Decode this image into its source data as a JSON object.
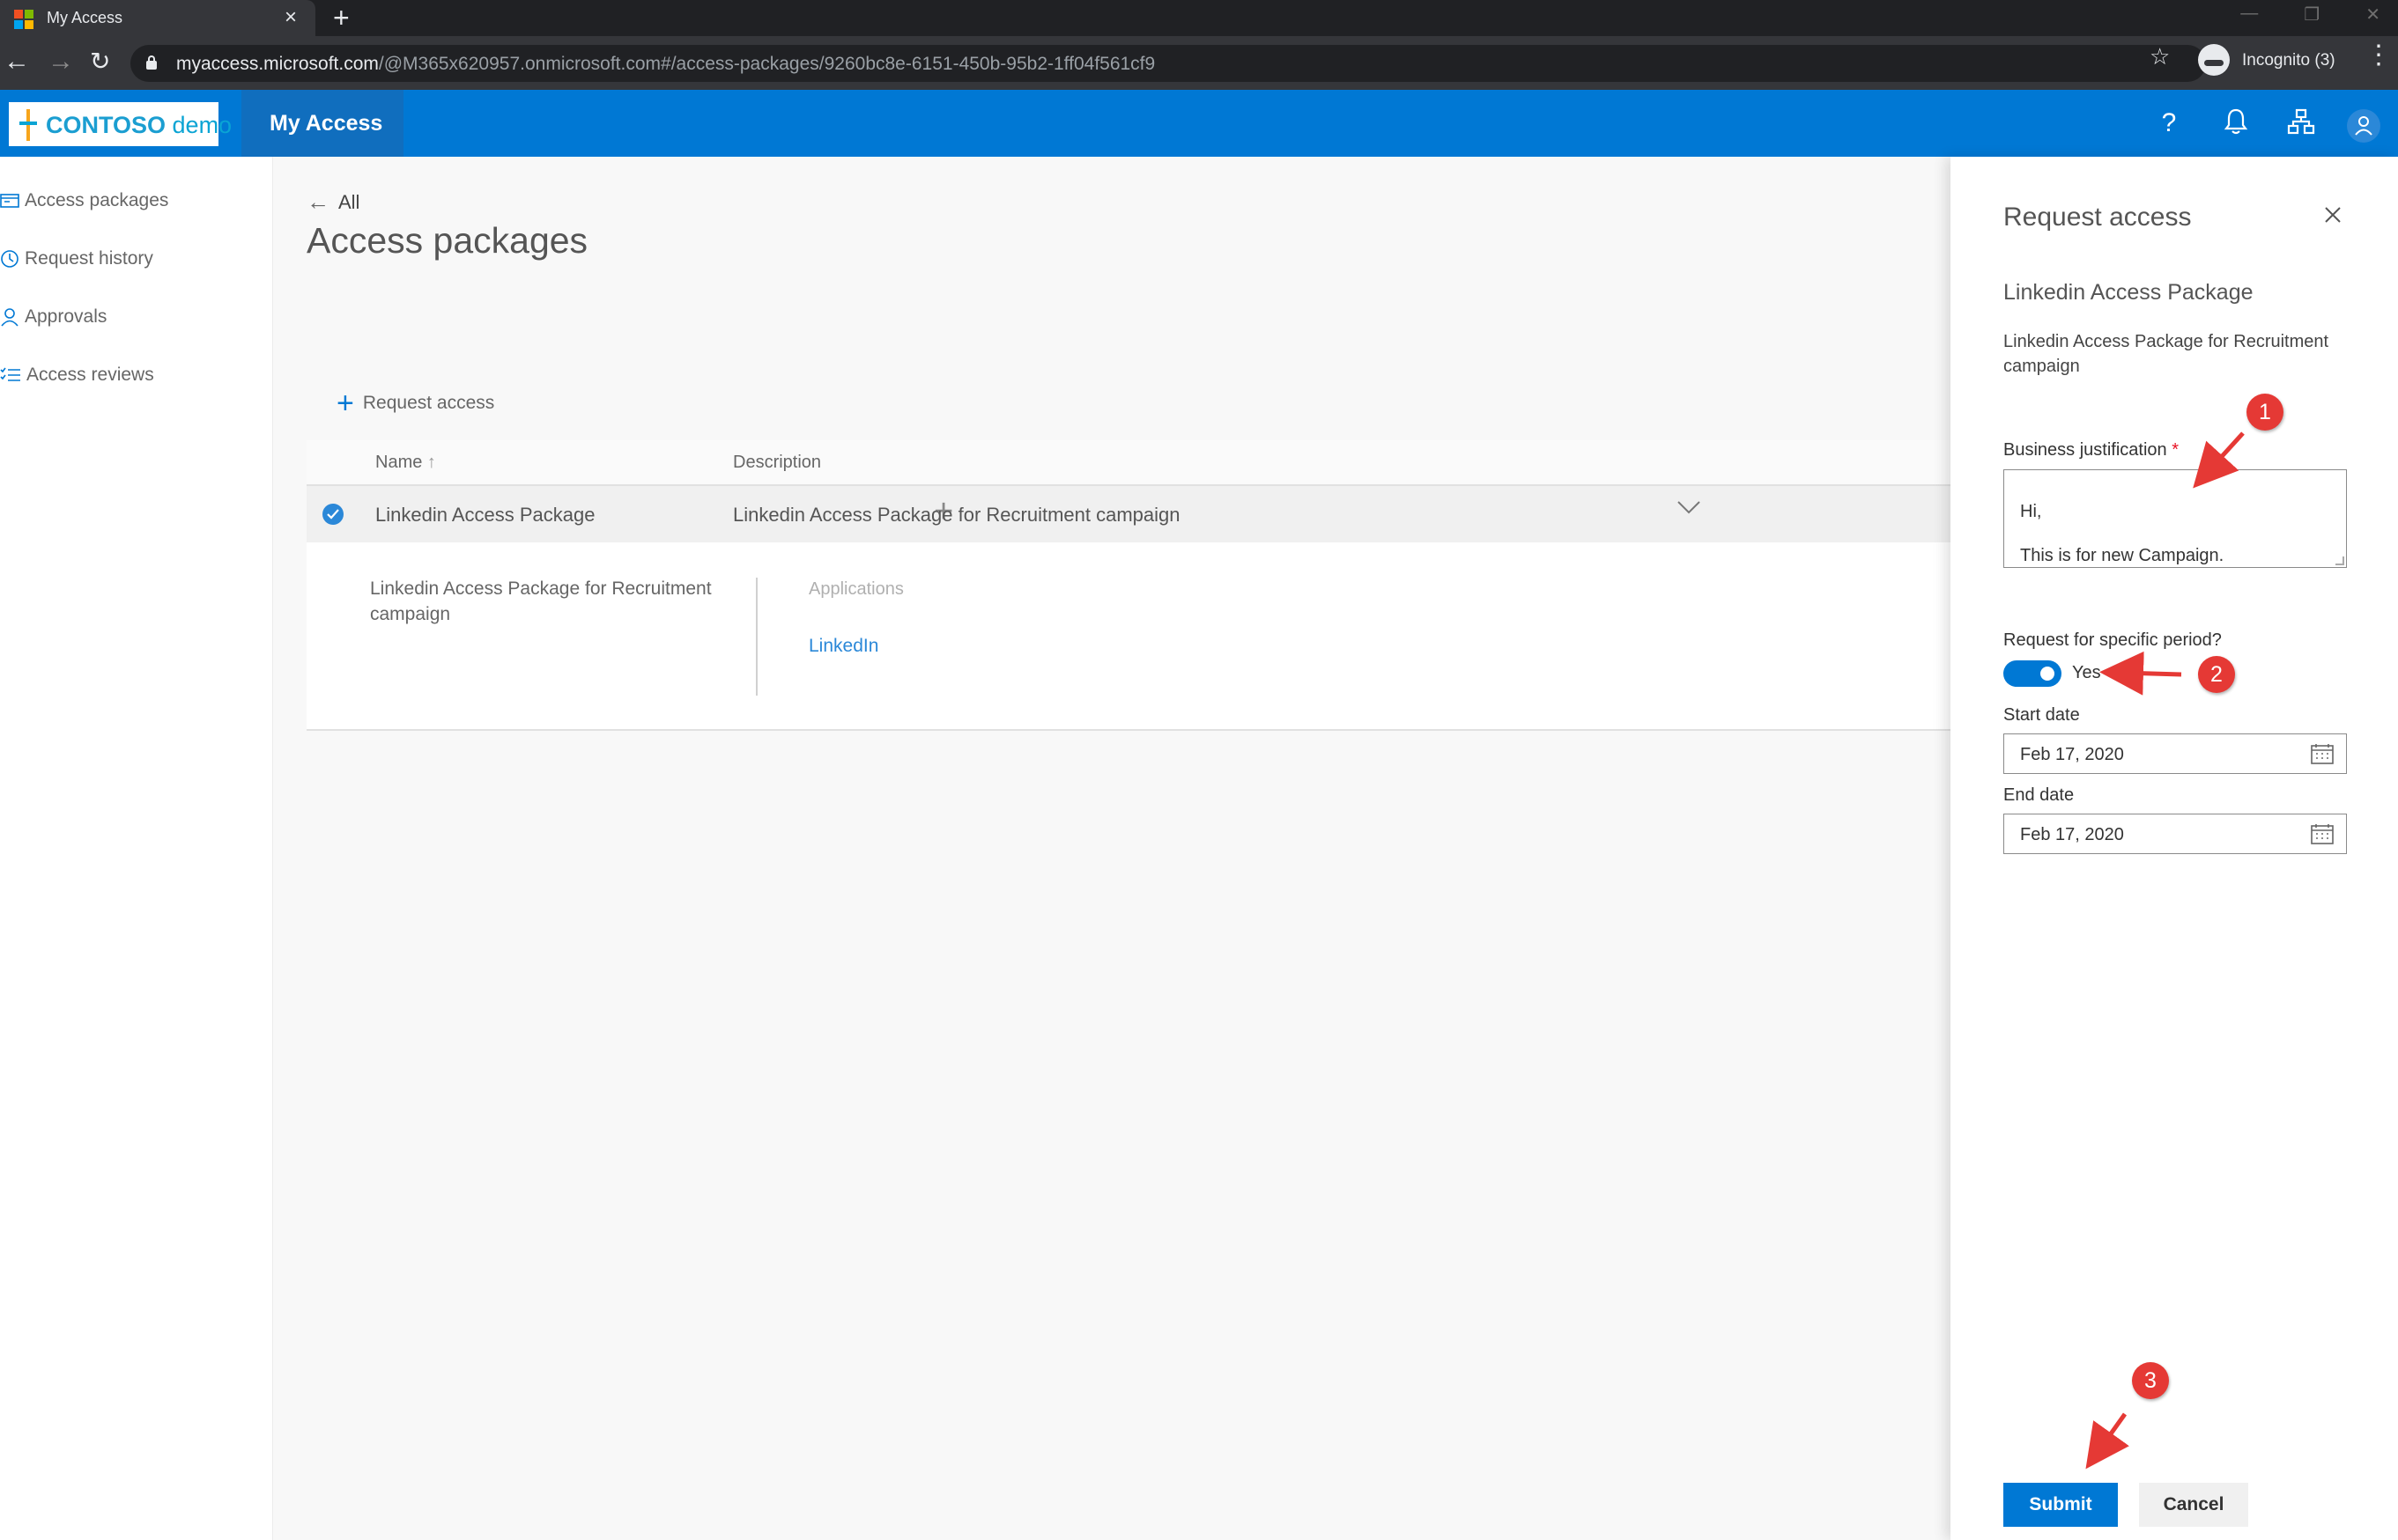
{
  "browser": {
    "tab_title": "My Access",
    "url_host": "myaccess.microsoft.com",
    "url_path": "/@M365x620957.onmicrosoft.com#/access-packages/9260bc8e-6151-450b-95b2-1ff04f561cf9",
    "incognito_label": "Incognito (3)"
  },
  "header": {
    "logo_brand": "CONTOSO",
    "logo_suffix": "demo",
    "app_title": "My Access",
    "icons": [
      "help-icon",
      "notification-bell-icon",
      "org-chart-icon",
      "user-avatar-icon"
    ],
    "accent_color": "#0078d4"
  },
  "sidebar": {
    "items": [
      {
        "label": "Access packages",
        "icon": "access-packages-icon"
      },
      {
        "label": "Request history",
        "icon": "history-icon"
      },
      {
        "label": "Approvals",
        "icon": "person-icon"
      },
      {
        "label": "Access reviews",
        "icon": "checklist-icon"
      }
    ]
  },
  "main": {
    "back_label": "All",
    "page_title": "Access packages",
    "request_access_label": "Request access",
    "columns": {
      "name": "Name",
      "description": "Description"
    },
    "row": {
      "name": "Linkedin Access Package",
      "description": "Linkedin Access Package for Recruitment campaign",
      "selected": true
    },
    "detail": {
      "description": "Linkedin Access Package for Recruitment campaign",
      "applications_label": "Applications",
      "applications": [
        "LinkedIn"
      ]
    }
  },
  "panel": {
    "title": "Request access",
    "package_name": "Linkedin Access Package",
    "package_description": "Linkedin Access Package for Recruitment campaign",
    "justification_label": "Business justification",
    "justification_required_mark": "*",
    "justification_value": "Hi,\n\nThis is for new Campaign.",
    "period_label": "Request for specific period?",
    "period_toggle_text": "Yes",
    "period_enabled": true,
    "start_date_label": "Start date",
    "start_date_value": "Feb 17, 2020",
    "end_date_label": "End date",
    "end_date_value": "Feb 17, 2020",
    "submit_label": "Submit",
    "cancel_label": "Cancel"
  },
  "annotations": {
    "badge_1": "1",
    "badge_2": "2",
    "badge_3": "3",
    "color": "#e53935"
  }
}
